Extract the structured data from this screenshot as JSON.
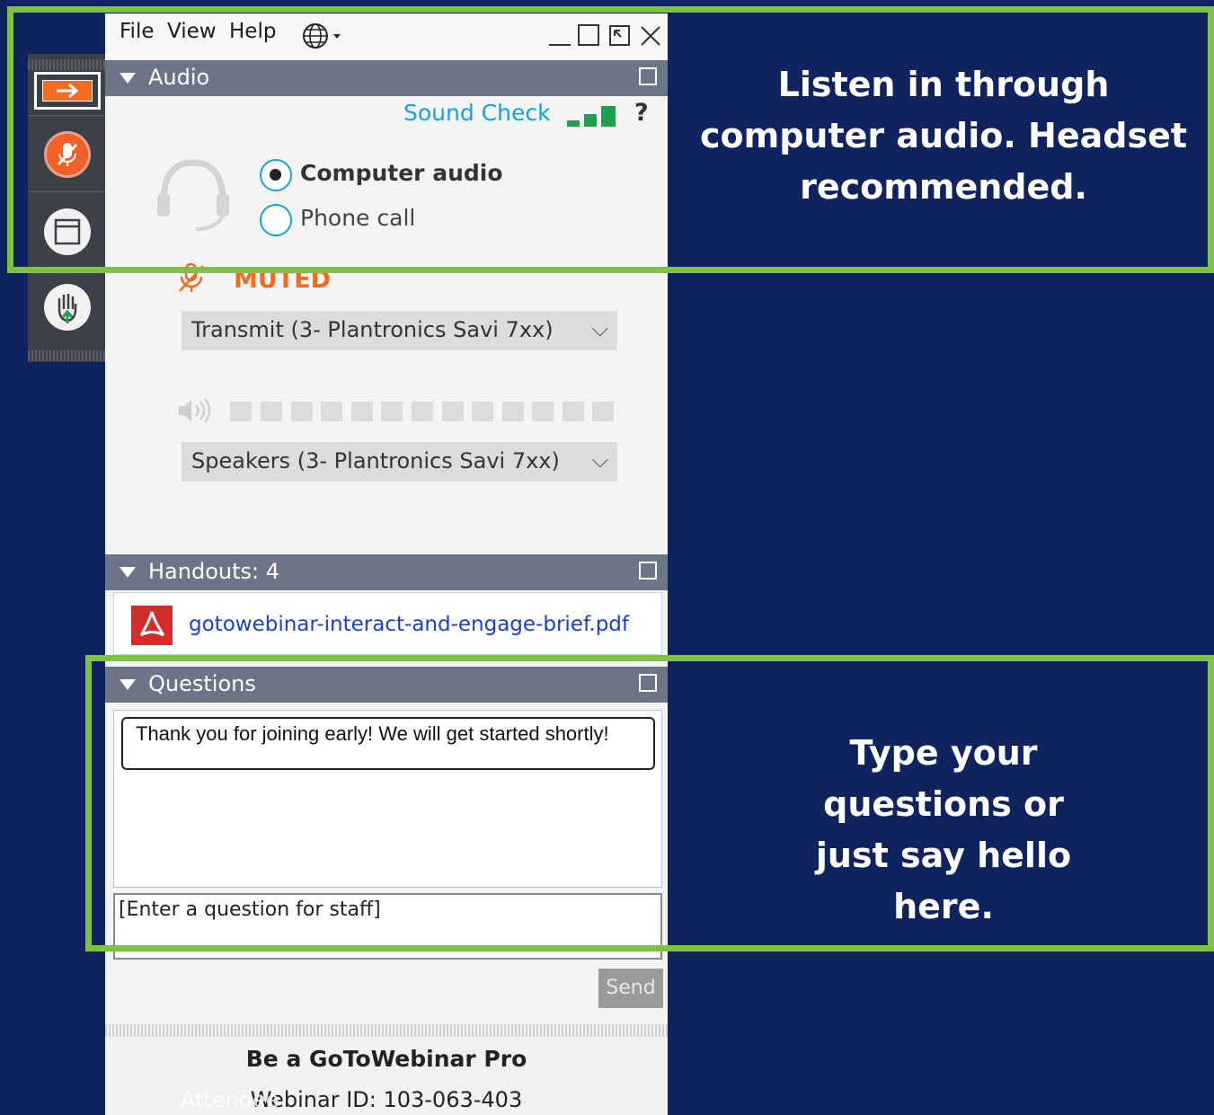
{
  "menu": {
    "file": "File",
    "view": "View",
    "help": "Help",
    "language_icon": "globe-icon",
    "minimize_icon": "minimize-icon",
    "maximize_icon": "maximize-icon",
    "popout_icon": "popout-icon",
    "close_icon": "close-icon"
  },
  "audio": {
    "title": "Audio",
    "sound_check": "Sound Check",
    "help": "?",
    "options": [
      {
        "label": "Computer audio",
        "selected": true
      },
      {
        "label": "Phone call",
        "selected": false
      }
    ],
    "muted_label": "MUTED",
    "transmit_device": "Transmit (3- Plantronics Savi 7xx)",
    "speaker_device": "Speakers (3- Plantronics Savi 7xx)"
  },
  "handouts": {
    "title": "Handouts: 4",
    "file": "gotowebinar-interact-and-engage-brief.pdf"
  },
  "questions": {
    "title": "Questions",
    "message": "Thank you for joining early!  We will get started shortly!",
    "input_placeholder": "[Enter a question for staff]",
    "send_label": "Send"
  },
  "footer": {
    "pro_title": "Be a GoToWebinar Pro",
    "webinar_id": "Webinar ID: 103-063-403",
    "overlay": "Attendee"
  },
  "callouts": {
    "audio_note": "Listen in through computer audio. Headset recommended.",
    "questions_note": "Type your questions or just say hello here."
  },
  "colors": {
    "background": "#0f235e",
    "highlight": "#7dc243",
    "accent_orange": "#f26b21",
    "sound_check": "#1aa0d8",
    "signal_green": "#1e9f4e",
    "link_blue": "#1a3fcf"
  }
}
